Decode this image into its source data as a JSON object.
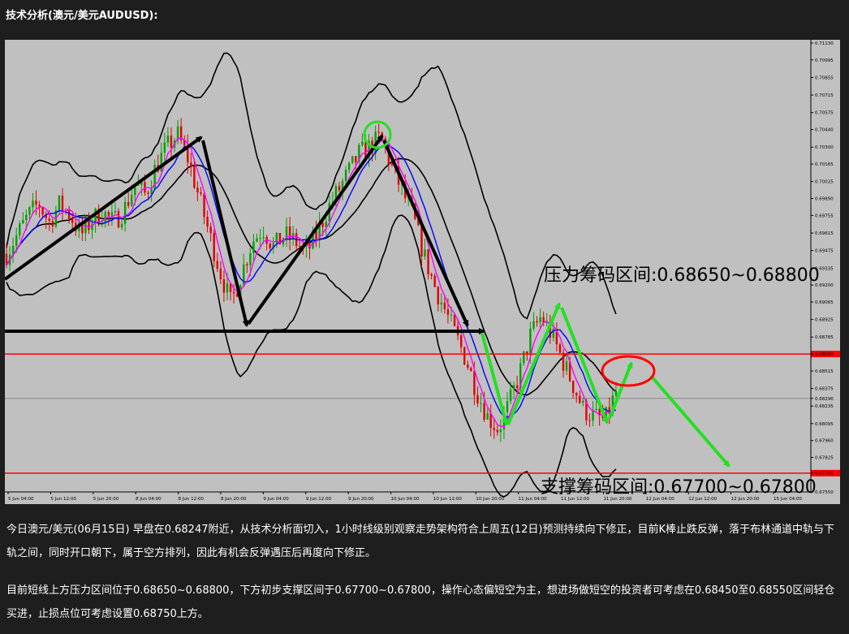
{
  "heading": "技术分析(澳元/美元AUDUSD):",
  "chart_data": {
    "type": "candlestick",
    "x_tick_labels": [
      "5 Jun 04:00",
      "5 Jun 12:00",
      "5 Jun 20:00",
      "8 Jun 04:00",
      "8 Jun 12:00",
      "8 Jun 20:00",
      "9 Jun 04:00",
      "9 Jun 12:00",
      "9 Jun 20:00",
      "10 Jun 04:00",
      "10 Jun 12:00",
      "10 Jun 20:00",
      "11 Jun 04:00",
      "11 Jun 12:00",
      "11 Jun 20:00",
      "12 Jun 04:00",
      "12 Jun 12:00",
      "12 Jun 20:00",
      "15 Jun 04:00"
    ],
    "y_tick_labels": [
      "0.71130",
      "0.70995",
      "0.70855",
      "0.70715",
      "0.70575",
      "0.70440",
      "0.70300",
      "0.70165",
      "0.70025",
      "0.69890",
      "0.69755",
      "0.69615",
      "0.69475",
      "0.69335",
      "0.69200",
      "0.69065",
      "0.68925",
      "0.68785",
      "0.68650",
      "0.68515",
      "0.68375",
      "0.68296",
      "0.68235",
      "0.68095",
      "0.67960",
      "0.67825",
      "0.67701",
      "0.67550"
    ],
    "ylim": [
      0.6755,
      0.7113
    ],
    "last_price": "0.68296",
    "price_path": [
      0.6945,
      0.696,
      0.6975,
      0.6985,
      0.697,
      0.6985,
      0.6975,
      0.696,
      0.6972,
      0.6978,
      0.697,
      0.698,
      0.7,
      0.6992,
      0.7015,
      0.703,
      0.704,
      0.702,
      0.699,
      0.696,
      0.693,
      0.6905,
      0.693,
      0.6955,
      0.6965,
      0.695,
      0.696,
      0.6955,
      0.6945,
      0.696,
      0.698,
      0.6995,
      0.701,
      0.7025,
      0.703,
      0.7038,
      0.7015,
      0.6995,
      0.6975,
      0.6945,
      0.692,
      0.69,
      0.688,
      0.686,
      0.6835,
      0.6815,
      0.6805,
      0.6825,
      0.685,
      0.688,
      0.6895,
      0.688,
      0.686,
      0.684,
      0.682,
      0.6815,
      0.6812,
      0.6835
    ],
    "lines": {
      "resistance": 0.6865,
      "support": 0.677
    },
    "annotations": {
      "resistance_label": "压力筹码区间:0.68650~0.68800",
      "support_label": "支撑筹码区间:0.67700~0.67800"
    },
    "colors": {
      "background": "#c0c0c0",
      "bull": "#00a000",
      "bear": "#e00000",
      "band": "#000000",
      "ma_fast": "#ff00ff",
      "ma_slow": "#0000ff",
      "arrow_black": "#000000",
      "arrow_green": "#22e022",
      "circle_green": "#22e022",
      "circle_red": "#ff0000",
      "level_line": "#ff0000"
    }
  },
  "paragraphs": [
    "今日澳元/美元(06月15日) 早盘在0.68247附近，从技术分析面切入，1小时线级别观察走势架构符合上周五(12日)预测持续向下修正，目前K棒止跌反弹，落于布林通道中轨与下轨之间，同时开口朝下，属于空方排列，因此有机会反弹遇压后再度向下修正。",
    "目前短线上方压力区间位于0.68650~0.68800，下方初步支撑区间于0.67700~0.67800，操作心态偏短空为主，想进场做短空的投资者可考虑在0.68450至0.68550区间轻仓买进，止损点位可考虑设置0.68750上方。"
  ]
}
